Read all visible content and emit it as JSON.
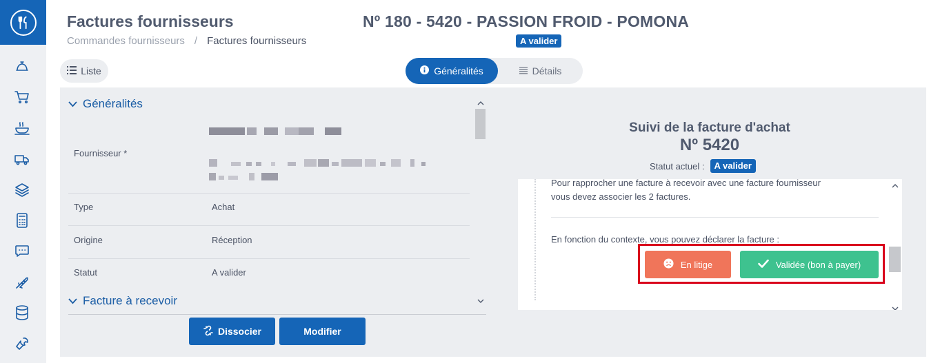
{
  "header": {
    "page_title": "Factures fournisseurs",
    "breadcrumb": [
      "Commandes fournisseurs",
      "/",
      "Factures fournisseurs"
    ],
    "document_title": "Nº 180 - 5420 - PASSION FROID - POMONA",
    "status_badge": "A valider"
  },
  "sidebar": {
    "logo": "cutlery-icon",
    "items": [
      "bell-icon",
      "cart-icon",
      "soup-icon",
      "truck-icon",
      "layers-icon",
      "calculator-icon",
      "chat-icon",
      "fish-icon",
      "database-icon",
      "wrench-icon"
    ]
  },
  "toolbar": {
    "list_label": "Liste",
    "tabs": [
      {
        "label": "Généralités",
        "icon": "info-icon",
        "active": true
      },
      {
        "label": "Détails",
        "icon": "list-icon",
        "active": false
      }
    ]
  },
  "generalites": {
    "section_title": "Généralités",
    "fields": [
      {
        "label": "Fournisseur *",
        "value": ""
      },
      {
        "label": "Type",
        "value": "Achat"
      },
      {
        "label": "Origine",
        "value": "Réception"
      },
      {
        "label": "Statut",
        "value": "A valider"
      }
    ],
    "next_section_title": "Facture à recevoir"
  },
  "actions": {
    "dissocier": "Dissocier",
    "modifier": "Modifier"
  },
  "tracking": {
    "title": "Suivi de la facture d'achat",
    "number": "Nº 5420",
    "status_label": "Statut actuel :",
    "status_value": "A valider",
    "text_1": "Pour rapprocher une facture à recevoir avec une facture fournisseur",
    "text_2": "vous devez associer les 2 factures.",
    "text_3": "En fonction du contexte, vous pouvez déclarer la facture :",
    "btn_dispute": "En litige",
    "btn_valid": "Validée (bon à payer)"
  },
  "colors": {
    "primary": "#1565b7",
    "dispute": "#f0755a",
    "valid": "#3ec28f",
    "highlight": "#d9001b"
  }
}
